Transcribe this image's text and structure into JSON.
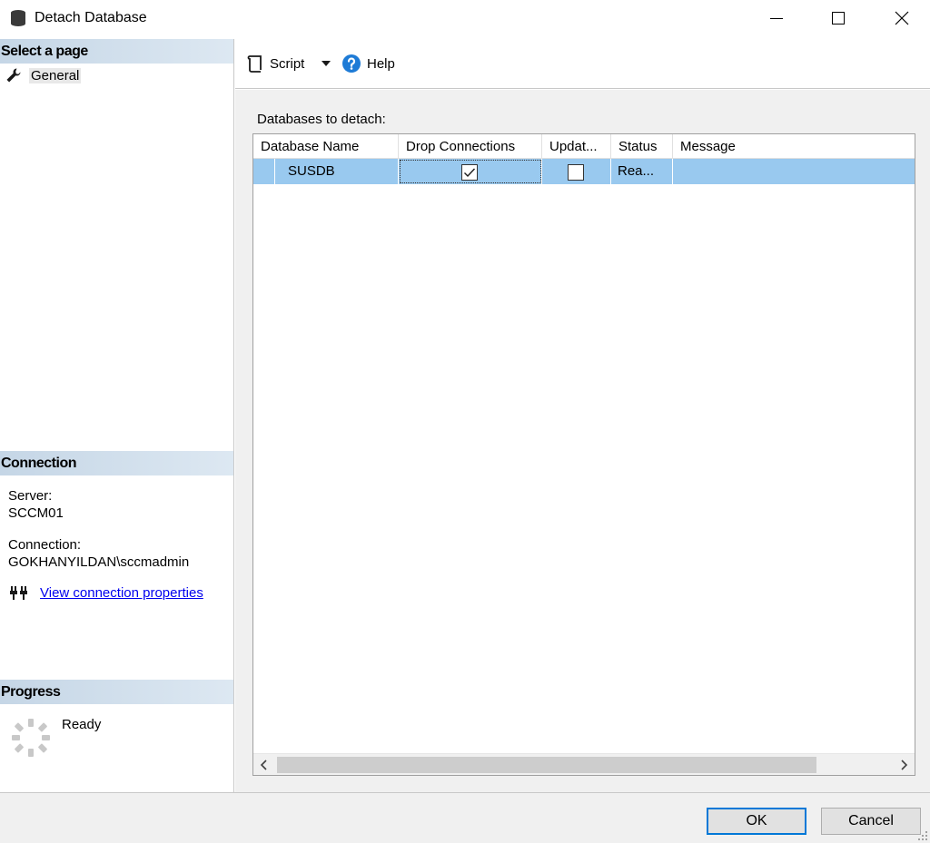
{
  "window": {
    "title": "Detach Database"
  },
  "left": {
    "select_page_header": "Select a page",
    "pages": [
      {
        "label": "General"
      }
    ],
    "connection_header": "Connection",
    "server_label": "Server:",
    "server_value": "SCCM01",
    "connection_label": "Connection:",
    "connection_value": "GOKHANYILDAN\\sccmadmin",
    "view_connection_link": "View connection properties",
    "progress_header": "Progress",
    "progress_status": "Ready"
  },
  "toolbar": {
    "script_label": "Script",
    "help_label": "Help"
  },
  "grid": {
    "caption": "Databases to detach:",
    "columns": [
      "Database Name",
      "Drop Connections",
      "Updat...",
      "Status",
      "Message"
    ],
    "rows": [
      {
        "database_name": "SUSDB",
        "drop_connections": true,
        "update_statistics": false,
        "status": "Rea...",
        "message": ""
      }
    ]
  },
  "buttons": {
    "ok": "OK",
    "cancel": "Cancel"
  },
  "colors": {
    "selection": "#99c9ef",
    "header_gradient": "#c5d6e6",
    "help_icon": "#1e7bd6",
    "link": "#0000ee"
  }
}
